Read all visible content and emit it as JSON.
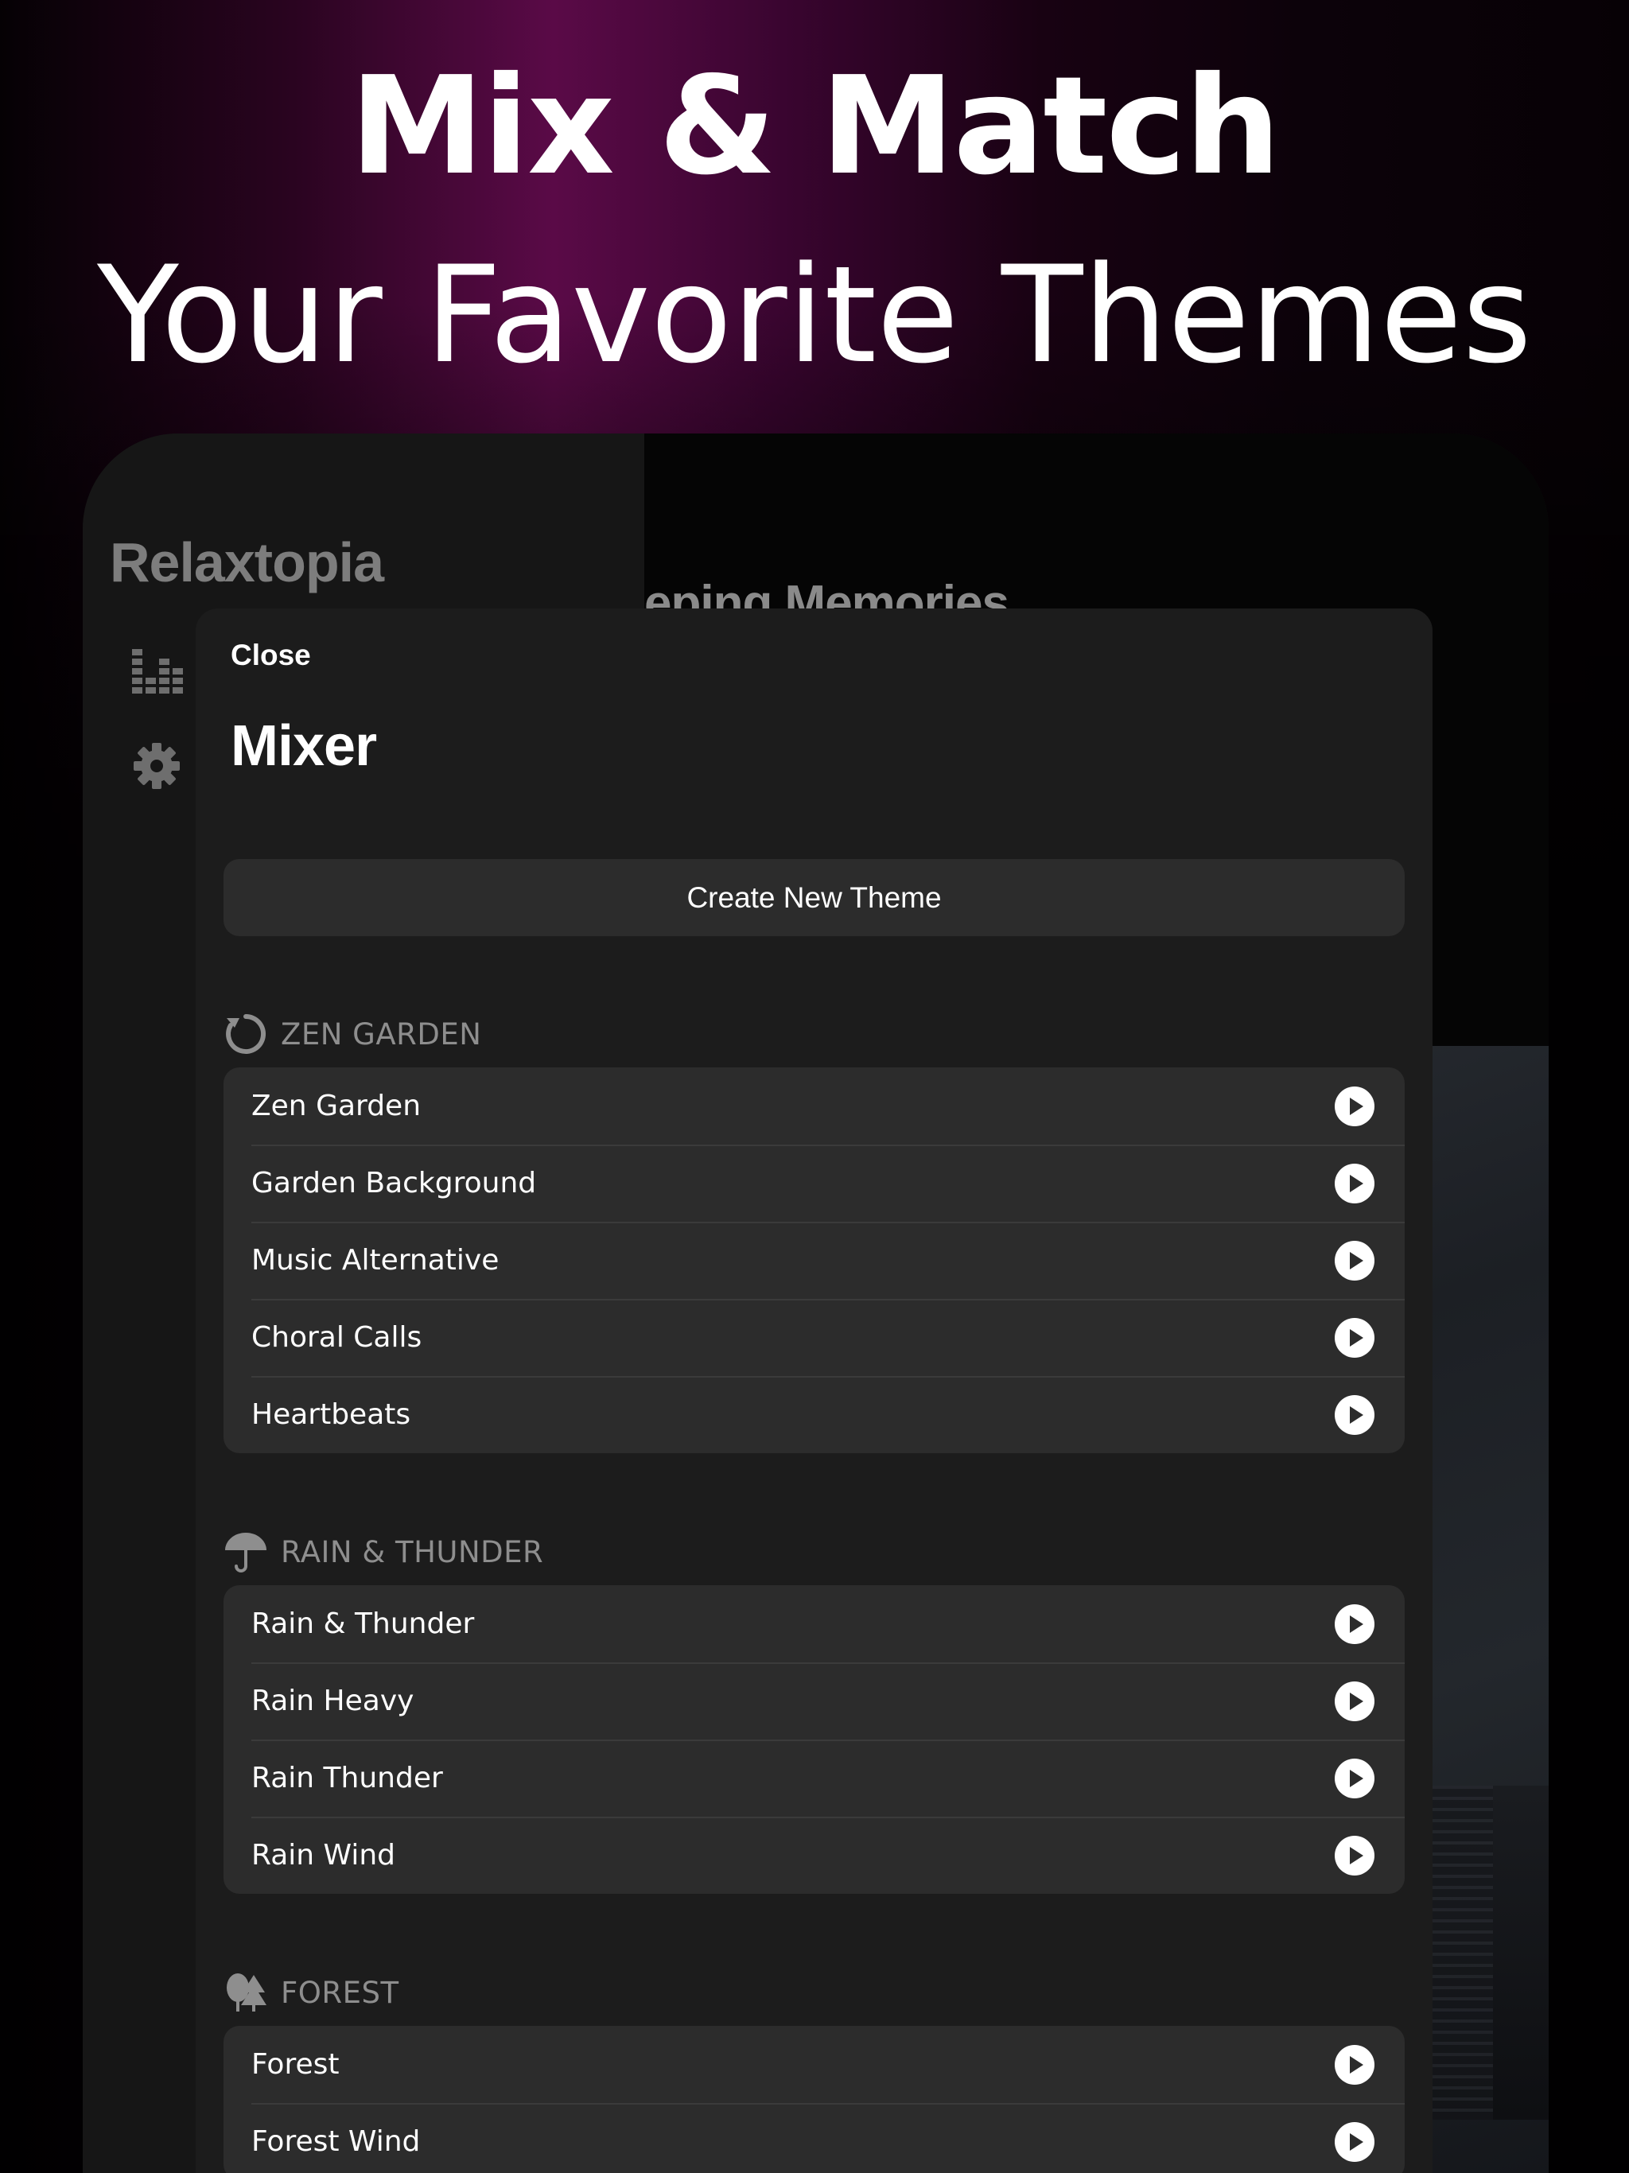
{
  "promo": {
    "headline_line1": "Mix & Match",
    "headline_line2": "Your Favorite Themes"
  },
  "app": {
    "title": "Relaxtopia",
    "sidebar_icons": [
      "equalizer-icon",
      "gear-icon"
    ],
    "background_title": "eping Memories"
  },
  "mixer": {
    "close_label": "Close",
    "title": "Mixer",
    "create_button": "Create New Theme",
    "sections": [
      {
        "icon": "refresh-circle-icon",
        "label": "ZEN GARDEN",
        "items": [
          "Zen Garden",
          "Garden Background",
          "Music Alternative",
          "Choral Calls",
          "Heartbeats"
        ]
      },
      {
        "icon": "umbrella-icon",
        "label": "RAIN & THUNDER",
        "items": [
          "Rain & Thunder",
          "Rain Heavy",
          "Rain Thunder",
          "Rain Wind"
        ]
      },
      {
        "icon": "trees-icon",
        "label": "FOREST",
        "items": [
          "Forest",
          "Forest Wind"
        ]
      }
    ]
  },
  "colors": {
    "accent_magenta": "#5a0a47",
    "sheet_bg": "#1c1c1c",
    "row_bg": "#2c2c2c",
    "muted_text": "#8e8e8e"
  }
}
